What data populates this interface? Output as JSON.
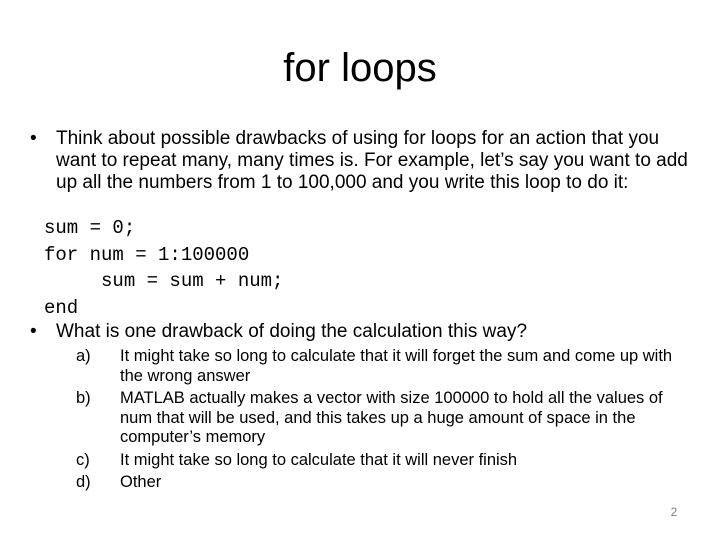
{
  "slide": {
    "title": "for loops",
    "bullet1": {
      "marker": "•",
      "text": "Think about possible drawbacks of using for loops for an action that you want to repeat many, many times is. For example, let’s say you want to add up all the numbers from 1 to 100,000 and you write this loop to do it:"
    },
    "code": [
      "sum = 0;",
      "for num = 1:100000",
      "     sum = sum + num;",
      "end"
    ],
    "bullet2": {
      "marker": "•",
      "text": "What is one drawback of doing the calculation this way?"
    },
    "answers": [
      {
        "label": "a)",
        "text": "It might take so long to calculate that it will forget the sum and come up with the wrong answer"
      },
      {
        "label": "b)",
        "text": "MATLAB actually makes a vector with size 100000 to hold all the values of num that will be used, and this takes up a huge amount of space in the computer’s memory"
      },
      {
        "label": "c)",
        "text": "It might take so long to calculate that it will never finish"
      },
      {
        "label": "d)",
        "text": "Other"
      }
    ],
    "page_number": "2"
  }
}
